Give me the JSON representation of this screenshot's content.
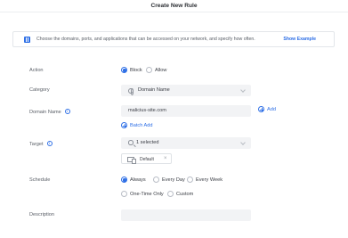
{
  "window": {
    "title": "Create New Rule"
  },
  "banner": {
    "text": "Choose the domains, ports, and applications that can be accessed on your network, and specify how often.",
    "link": "Show Example"
  },
  "action": {
    "label": "Action",
    "options": [
      {
        "label": "Block",
        "selected": true
      },
      {
        "label": "Allow",
        "selected": false
      }
    ]
  },
  "category": {
    "label": "Category",
    "value": "Domain Name"
  },
  "domain": {
    "label": "Domain Name",
    "value": "malicius-site.com",
    "add_label": "Add",
    "batch_add_label": "Batch Add"
  },
  "target": {
    "label": "Target",
    "value": "1 selected",
    "tag": "Default"
  },
  "schedule": {
    "label": "Schedule",
    "options": [
      {
        "label": "Always",
        "selected": true
      },
      {
        "label": "Every Day",
        "selected": false
      },
      {
        "label": "Every Week",
        "selected": false
      },
      {
        "label": "One-Time Only",
        "selected": false
      },
      {
        "label": "Custom",
        "selected": false
      }
    ]
  },
  "description": {
    "label": "Description",
    "value": ""
  },
  "colors": {
    "accent": "#2e6fe6",
    "field_bg": "#f2f3f5"
  },
  "icons": [
    "info-icon",
    "globe-icon",
    "help-icon",
    "add-circle-icon",
    "search-icon",
    "devices-icon",
    "close-icon",
    "chevron-down-icon"
  ]
}
